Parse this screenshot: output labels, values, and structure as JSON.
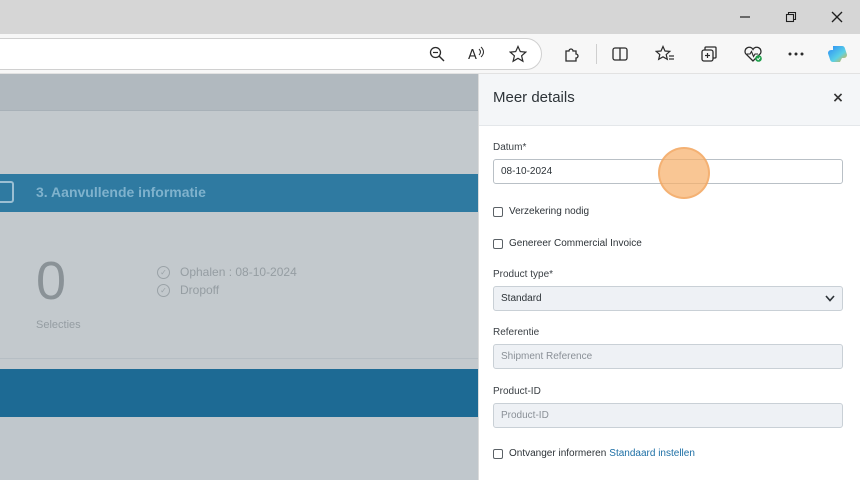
{
  "panel": {
    "title": "Meer details",
    "close_label": "×",
    "date_label": "Datum*",
    "date_value": "08-10-2024",
    "insurance_label": "Verzekering nodig",
    "invoice_label": "Genereer Commercial Invoice",
    "product_type_label": "Product type*",
    "product_type_value": "Standard",
    "reference_label": "Referentie",
    "reference_placeholder": "Shipment Reference",
    "product_id_label": "Product-ID",
    "product_id_placeholder": "Product-ID",
    "notify_label": "Ontvanger informeren",
    "notify_link": "Standaard instellen"
  },
  "background_page": {
    "step_title": "3. Aanvullende informatie",
    "selection_count": "0",
    "selection_label": "Selecties",
    "status_items": [
      "Ophalen : 08-10-2024",
      "Dropoff"
    ]
  },
  "browser": {
    "window_controls": [
      "minimize-icon",
      "restore-icon",
      "close-icon"
    ],
    "toolbar_icons": [
      "zoom-icon",
      "read-aloud-icon",
      "favorite-star-icon",
      "extensions-icon",
      "split-screen-icon",
      "favorites-icon",
      "collections-icon",
      "browser-essentials-icon",
      "more-icon",
      "copilot-icon"
    ]
  },
  "colors": {
    "accent_blue": "#1d6a94",
    "link_blue": "#1d6fa5",
    "cursor_highlight": "#f7b06b"
  }
}
